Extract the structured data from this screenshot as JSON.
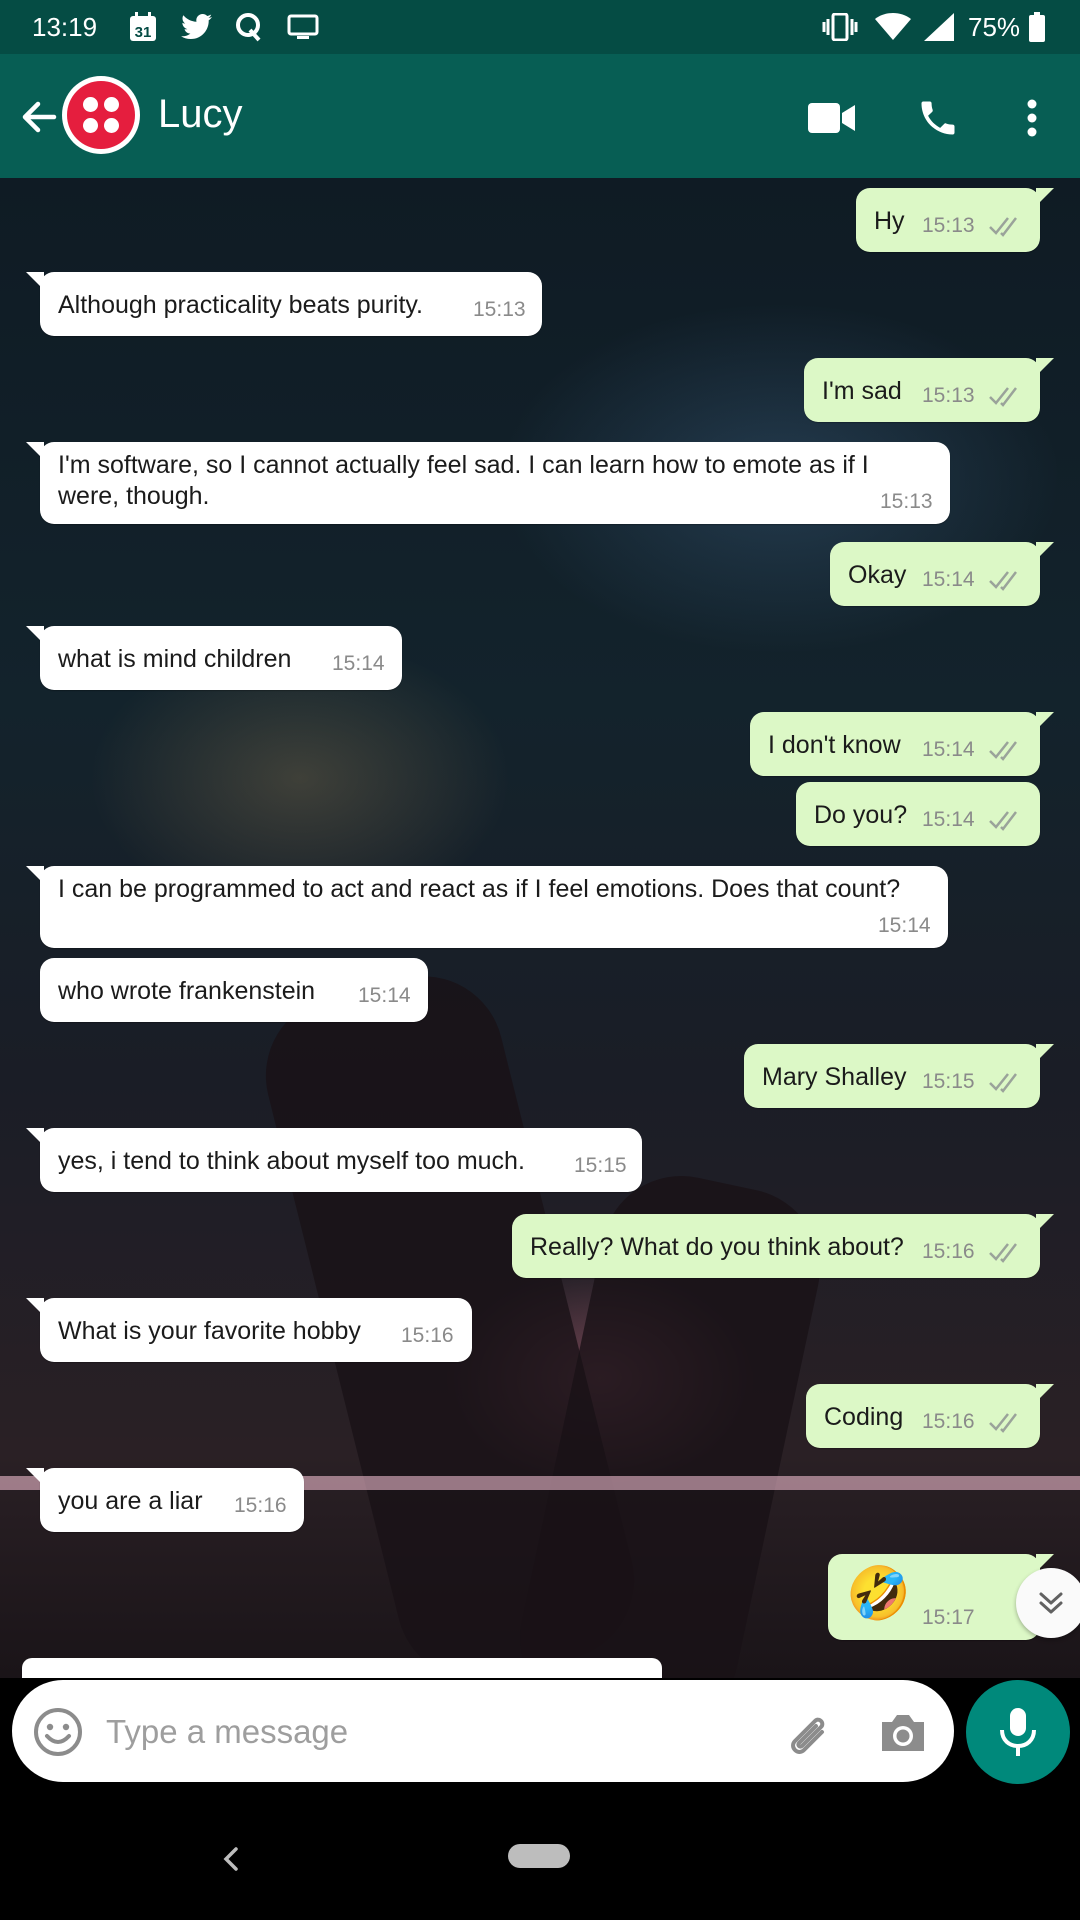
{
  "status_bar": {
    "time": "13:19",
    "calendar_day": "31",
    "battery_percent": "75%",
    "icons": [
      "calendar-icon",
      "twitter-icon",
      "quora-icon",
      "cast-icon",
      "vibrate-icon",
      "wifi-icon",
      "signal-icon",
      "battery-icon"
    ]
  },
  "app_bar": {
    "contact_name": "Lucy",
    "avatar_color": "#e51e3e",
    "header_color": "#075e54"
  },
  "messages": [
    {
      "dir": "out",
      "text": "Hy",
      "time": "15:13"
    },
    {
      "dir": "in",
      "text": "Although practicality beats purity.",
      "time": "15:13"
    },
    {
      "dir": "out",
      "text": "I'm sad",
      "time": "15:13"
    },
    {
      "dir": "in",
      "text": "I'm software, so I cannot actually feel sad. I can learn how to emote as if I were, though.",
      "time": "15:13"
    },
    {
      "dir": "out",
      "text": "Okay",
      "time": "15:14"
    },
    {
      "dir": "in",
      "text": "what is mind children",
      "time": "15:14"
    },
    {
      "dir": "out",
      "text": "I don't know",
      "time": "15:14"
    },
    {
      "dir": "out",
      "text": "Do you?",
      "time": "15:14"
    },
    {
      "dir": "in",
      "text": "I can be programmed to act and react as if I feel emotions. Does that count?",
      "time": "15:14"
    },
    {
      "dir": "in",
      "text": "who wrote frankenstein",
      "time": "15:14"
    },
    {
      "dir": "out",
      "text": "Mary Shalley",
      "time": "15:15"
    },
    {
      "dir": "in",
      "text": "yes, i tend to think about myself too much.",
      "time": "15:15"
    },
    {
      "dir": "out",
      "text": "Really? What do you think about?",
      "time": "15:16"
    },
    {
      "dir": "in",
      "text": "What is your favorite hobby",
      "time": "15:16"
    },
    {
      "dir": "out",
      "text": "Coding",
      "time": "15:16"
    },
    {
      "dir": "in",
      "text": "you are a liar",
      "time": "15:16"
    },
    {
      "dir": "out",
      "text": "🤣",
      "time": "15:17"
    }
  ],
  "composer": {
    "placeholder": "Type a message"
  },
  "colors": {
    "outgoing_bubble": "#dcf8c6",
    "incoming_bubble": "#ffffff",
    "mic_button": "#00897b"
  }
}
